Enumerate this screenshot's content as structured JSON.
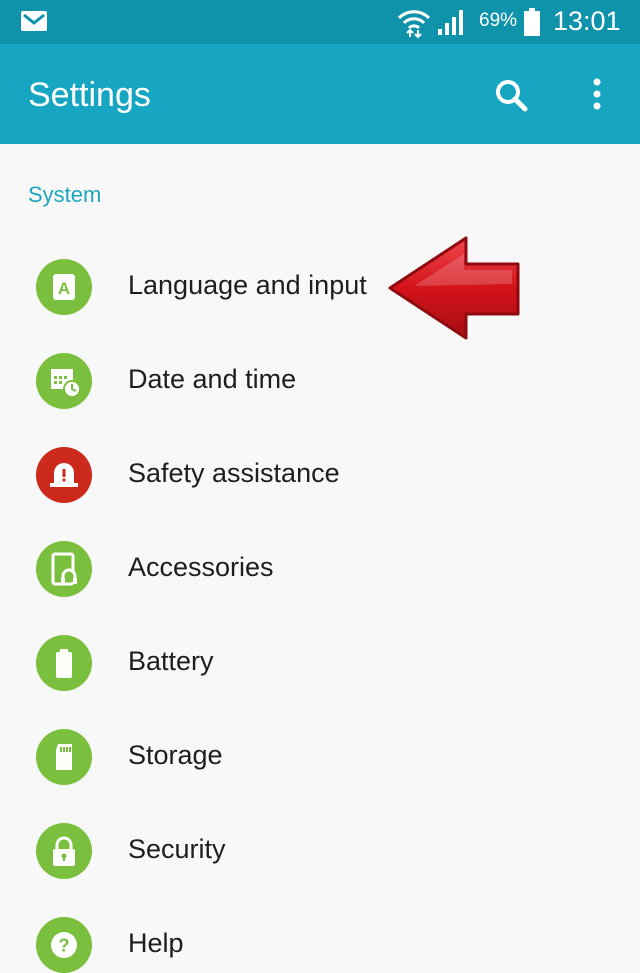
{
  "status_bar": {
    "battery_percent": "69%",
    "time": "13:01",
    "icons": [
      "mail-icon",
      "wifi-icon",
      "signal-icon",
      "battery-icon"
    ]
  },
  "app_bar": {
    "title": "Settings",
    "icons": [
      "search-icon",
      "more-options-icon"
    ]
  },
  "section": {
    "header": "System"
  },
  "items": [
    {
      "label": "Language and input",
      "icon": "language-icon"
    },
    {
      "label": "Date and time",
      "icon": "calendar-clock-icon"
    },
    {
      "label": "Safety assistance",
      "icon": "alert-siren-icon"
    },
    {
      "label": "Accessories",
      "icon": "accessories-icon"
    },
    {
      "label": "Battery",
      "icon": "battery-icon"
    },
    {
      "label": "Storage",
      "icon": "sd-card-icon"
    },
    {
      "label": "Security",
      "icon": "lock-icon"
    },
    {
      "label": "Help",
      "icon": "help-icon"
    }
  ],
  "annotation": {
    "type": "red-arrow",
    "points_to": "Language and input"
  },
  "colors": {
    "status_bar": "#0f93ab",
    "app_bar": "#17a6c1",
    "accent": "#1ea5be",
    "icon_green": "#7bbf3f",
    "icon_red": "#cc2a1c",
    "arrow_red": "#d3131b"
  }
}
